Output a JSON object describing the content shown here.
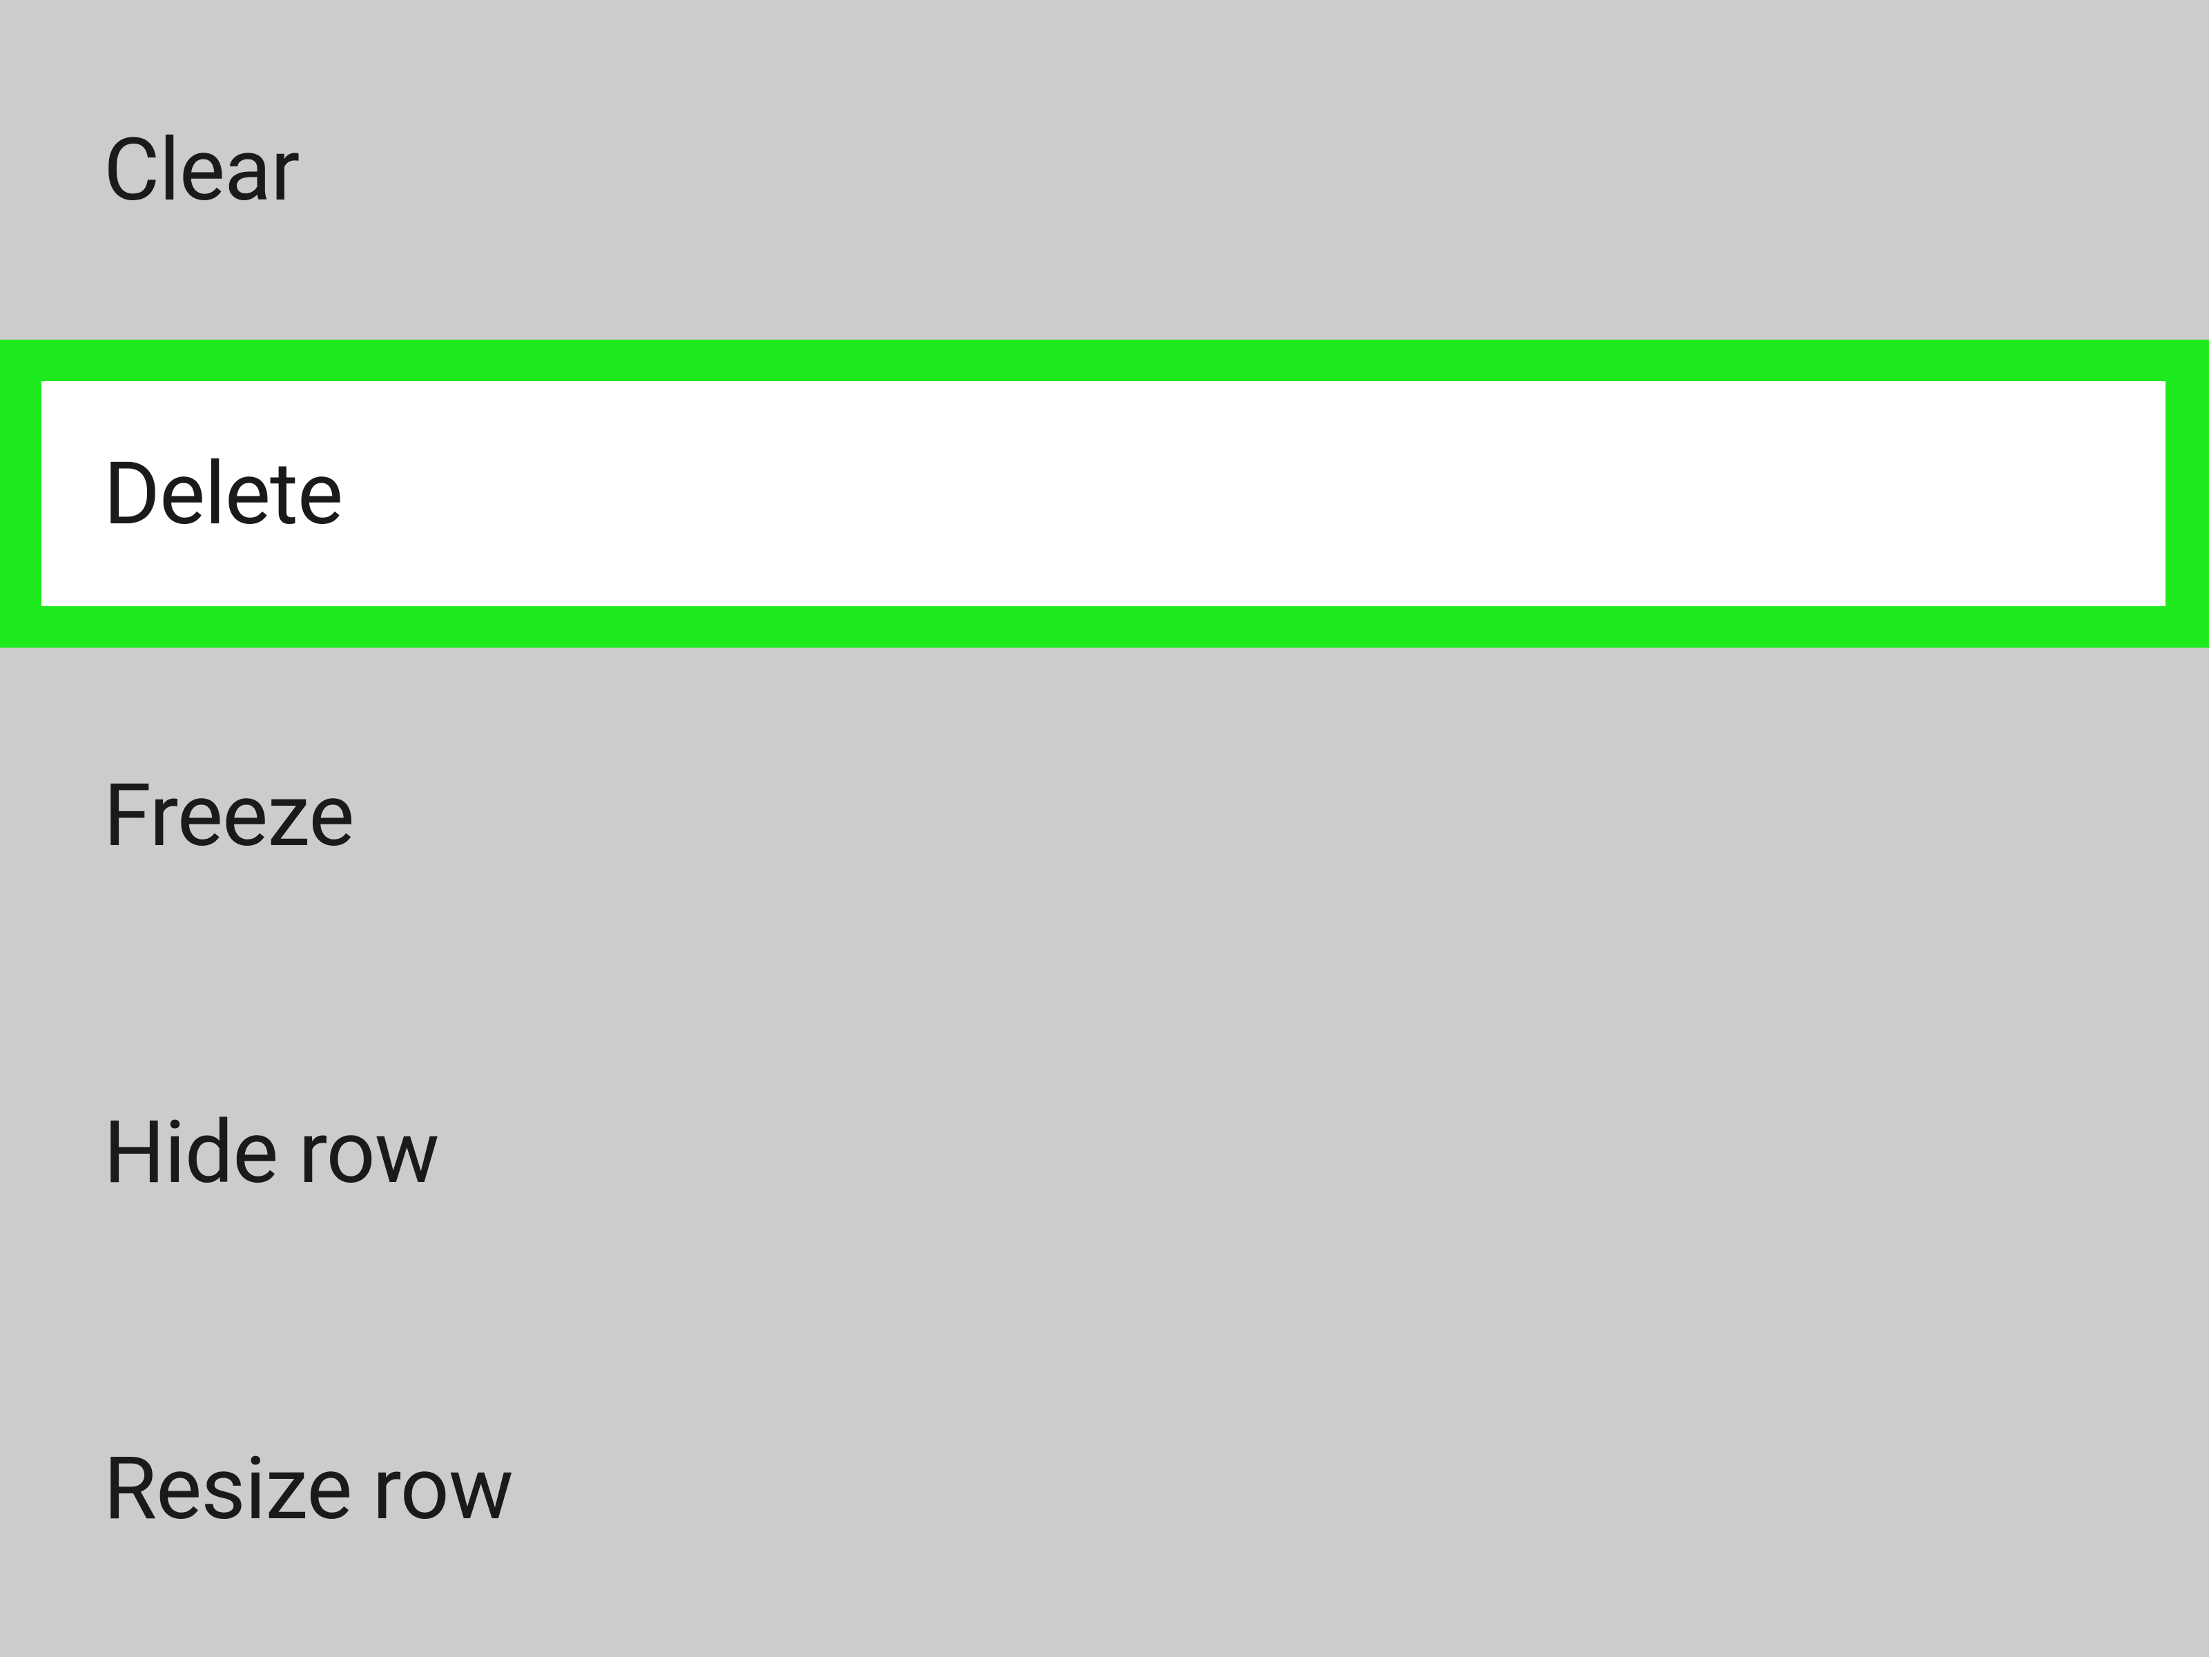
{
  "menu": {
    "items": [
      {
        "label": "Clear",
        "highlighted": false
      },
      {
        "label": "Delete",
        "highlighted": true
      },
      {
        "label": "Freeze",
        "highlighted": false
      },
      {
        "label": "Hide row",
        "highlighted": false
      },
      {
        "label": "Resize row",
        "highlighted": false
      }
    ],
    "highlight_color": "#1eeb1e",
    "background_color": "#cccccc"
  }
}
